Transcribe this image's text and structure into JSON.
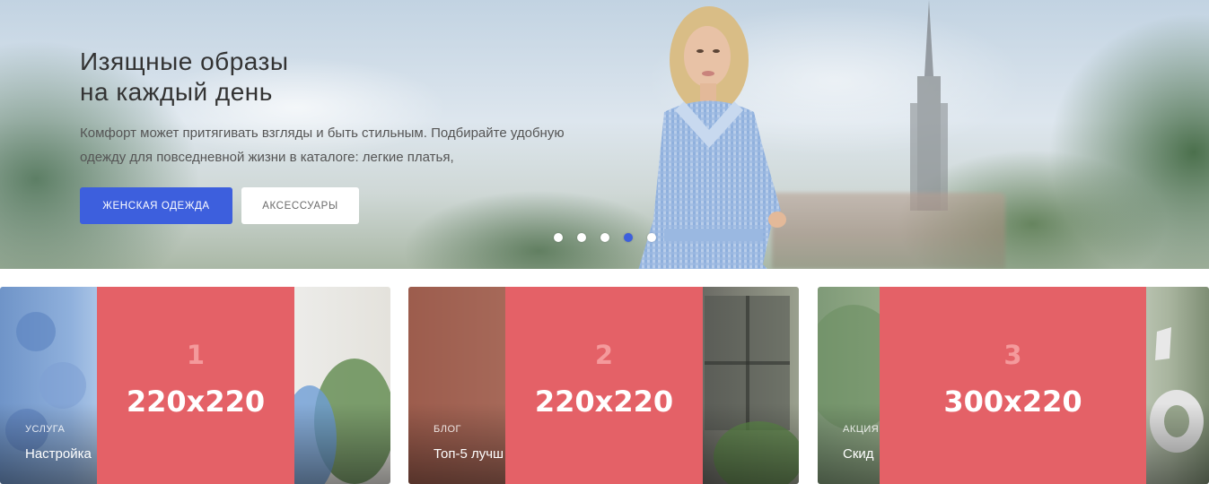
{
  "hero": {
    "title_line1": "Изящные образы",
    "title_line2": "на каждый день",
    "description": "Комфорт может притягивать взгляды и быть стильным. Подбирайте удобную одежду для повседневной жизни в каталоге: легкие платья,",
    "primary_button": "ЖЕНСКАЯ ОДЕЖДА",
    "secondary_button": "АКСЕССУАРЫ",
    "slides_total": 5,
    "active_slide": 4
  },
  "cards": [
    {
      "tag": "УСЛУГА",
      "title": "Настройка",
      "placeholder_number": "1",
      "placeholder_size": "220x220"
    },
    {
      "tag": "БЛОГ",
      "title": "Топ-5 лучш",
      "placeholder_number": "2",
      "placeholder_size": "220x220"
    },
    {
      "tag": "АКЦИЯ",
      "title": "Скид",
      "placeholder_number": "3",
      "placeholder_size": "300x220"
    }
  ],
  "colors": {
    "accent": "#3d5fdd",
    "placeholder": "#e46167",
    "placeholder_number": "#f49a9c"
  }
}
